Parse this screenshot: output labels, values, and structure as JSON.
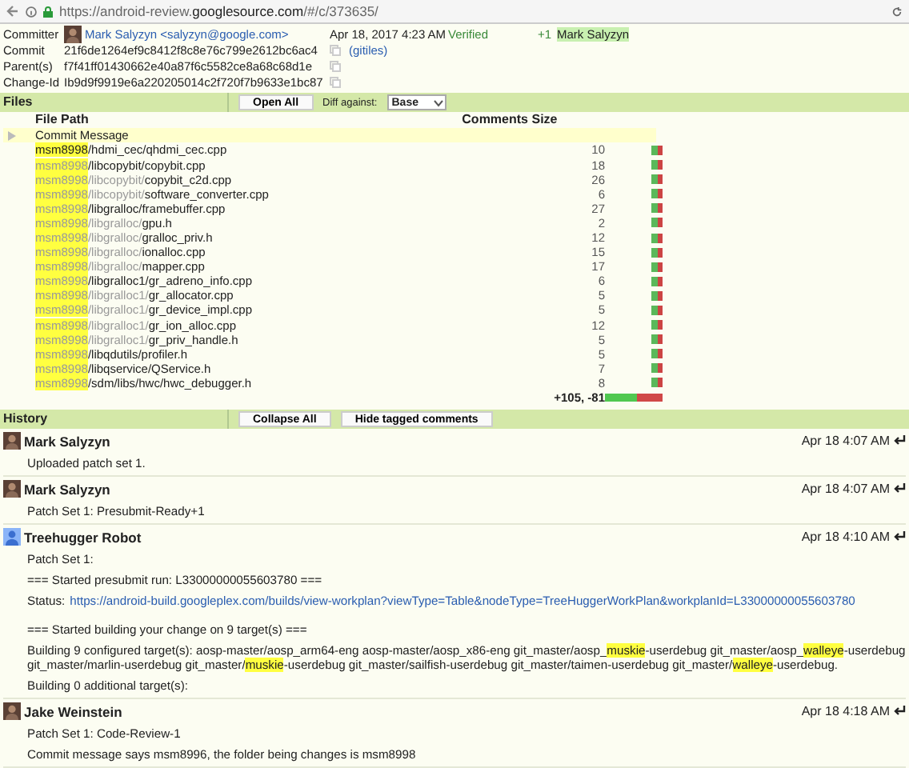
{
  "browser": {
    "url": "https://android-review.**googlesource.com**/#/c/373635/"
  },
  "info": {
    "rows": [
      {
        "label": "Committer",
        "value": "Mark Salyzyn <salyzyn@google.com>",
        "date": "Apr 18, 2017 4:23 AM",
        "copy": false
      },
      {
        "label": "Commit",
        "value": "21f6de1264ef9c8412f8c8e76c799e2612bc6ac4",
        "link": "(gitiles)",
        "copy": true
      },
      {
        "label": "Parent(s)",
        "value": "f7f41ff01430662e40a87f6c5582ce8a68c68d1e",
        "copy": true
      },
      {
        "label": "Change-Id",
        "value": "Ib9d9f9919e6a220205014c2f720f7b9633e1bc87",
        "copy": true
      }
    ],
    "label_name": "Verified",
    "vote": "+1",
    "voter": "Mark Salyzyn"
  },
  "files": {
    "title": "Files",
    "open_all": "Open All",
    "diff_label": "Diff against:",
    "diff_value": "Base",
    "columns": [
      "File Path",
      "Comments",
      "Size"
    ],
    "commit_message": "Commit Message",
    "rows": [
      {
        "path": [
          {
            "text": "msm8998",
            "highlighted": true,
            "dim": false
          },
          {
            "text": "/hdmi_cec/qhdmi_cec.cpp",
            "highlighted": false,
            "dim": false
          }
        ],
        "size": "10"
      },
      {
        "path": [
          {
            "text": "msm8998",
            "highlighted": true,
            "dim": true
          },
          {
            "text": "/libcopybit/copybit.cpp",
            "highlighted": false,
            "dim": false
          }
        ],
        "size": "18"
      },
      {
        "path": [
          {
            "text": "msm8998",
            "highlighted": true,
            "dim": true
          },
          {
            "text": "/libcopybit/",
            "highlighted": false,
            "dim": true
          },
          {
            "text": "copybit_c2d.cpp",
            "highlighted": false,
            "dim": false
          }
        ],
        "size": "26"
      },
      {
        "path": [
          {
            "text": "msm8998",
            "highlighted": true,
            "dim": true
          },
          {
            "text": "/libcopybit/",
            "highlighted": false,
            "dim": true
          },
          {
            "text": "software_converter.cpp",
            "highlighted": false,
            "dim": false
          }
        ],
        "size": "6"
      },
      {
        "path": [
          {
            "text": "msm8998",
            "highlighted": true,
            "dim": true
          },
          {
            "text": "/libgralloc/framebuffer.cpp",
            "highlighted": false,
            "dim": false
          }
        ],
        "size": "27"
      },
      {
        "path": [
          {
            "text": "msm8998",
            "highlighted": true,
            "dim": true
          },
          {
            "text": "/libgralloc/",
            "highlighted": false,
            "dim": true
          },
          {
            "text": "gpu.h",
            "highlighted": false,
            "dim": false
          }
        ],
        "size": "2"
      },
      {
        "path": [
          {
            "text": "msm8998",
            "highlighted": true,
            "dim": true
          },
          {
            "text": "/libgralloc/",
            "highlighted": false,
            "dim": true
          },
          {
            "text": "gralloc_priv.h",
            "highlighted": false,
            "dim": false
          }
        ],
        "size": "12"
      },
      {
        "path": [
          {
            "text": "msm8998",
            "highlighted": true,
            "dim": true
          },
          {
            "text": "/libgralloc/",
            "highlighted": false,
            "dim": true
          },
          {
            "text": "ionalloc.cpp",
            "highlighted": false,
            "dim": false
          }
        ],
        "size": "15"
      },
      {
        "path": [
          {
            "text": "msm8998",
            "highlighted": true,
            "dim": true
          },
          {
            "text": "/libgralloc/",
            "highlighted": false,
            "dim": true
          },
          {
            "text": "mapper.cpp",
            "highlighted": false,
            "dim": false
          }
        ],
        "size": "17"
      },
      {
        "path": [
          {
            "text": "msm8998",
            "highlighted": true,
            "dim": true
          },
          {
            "text": "/libgralloc1/gr_adreno_info.cpp",
            "highlighted": false,
            "dim": false
          }
        ],
        "size": "6"
      },
      {
        "path": [
          {
            "text": "msm8998",
            "highlighted": true,
            "dim": true
          },
          {
            "text": "/libgralloc1/",
            "highlighted": false,
            "dim": true
          },
          {
            "text": "gr_allocator.cpp",
            "highlighted": false,
            "dim": false
          }
        ],
        "size": "5"
      },
      {
        "path": [
          {
            "text": "msm8998",
            "highlighted": true,
            "dim": true
          },
          {
            "text": "/libgralloc1/",
            "highlighted": false,
            "dim": true
          },
          {
            "text": "gr_device_impl.cpp",
            "highlighted": false,
            "dim": false
          }
        ],
        "size": "5"
      },
      {
        "path": [
          {
            "text": "msm8998",
            "highlighted": true,
            "dim": true
          },
          {
            "text": "/libgralloc1/",
            "highlighted": false,
            "dim": true
          },
          {
            "text": "gr_ion_alloc.cpp",
            "highlighted": false,
            "dim": false
          }
        ],
        "size": "12"
      },
      {
        "path": [
          {
            "text": "msm8998",
            "highlighted": true,
            "dim": true
          },
          {
            "text": "/libgralloc1/",
            "highlighted": false,
            "dim": true
          },
          {
            "text": "gr_priv_handle.h",
            "highlighted": false,
            "dim": false
          }
        ],
        "size": "5"
      },
      {
        "path": [
          {
            "text": "msm8998",
            "highlighted": true,
            "dim": true
          },
          {
            "text": "/libqdutils/profiler.h",
            "highlighted": false,
            "dim": false
          }
        ],
        "size": "5"
      },
      {
        "path": [
          {
            "text": "msm8998",
            "highlighted": true,
            "dim": true
          },
          {
            "text": "/libqservice/QService.h",
            "highlighted": false,
            "dim": false
          }
        ],
        "size": "7"
      },
      {
        "path": [
          {
            "text": "msm8998",
            "highlighted": true,
            "dim": true
          },
          {
            "text": "/sdm/libs/hwc/hwc_debugger.h",
            "highlighted": false,
            "dim": false
          }
        ],
        "size": "8"
      }
    ],
    "total": "+105, -81",
    "total_bar": {
      "level": 0.56
    }
  },
  "history": {
    "title": "History",
    "buttons": [
      "Collapse All",
      "Hide tagged comments"
    ],
    "entries": [
      {
        "author": "Mark Salyzyn",
        "kind": "person",
        "date": "Apr 18 4:07 AM",
        "paragraphs": [
          [
            {
              "kind": "text",
              "text": "Uploaded patch set 1."
            }
          ]
        ]
      },
      {
        "author": "Mark Salyzyn",
        "kind": "person",
        "date": "Apr 18 4:07 AM",
        "paragraphs": [
          [
            {
              "kind": "text",
              "text": "Patch Set 1: Presubmit-Ready+1"
            }
          ]
        ]
      },
      {
        "author": "Treehugger Robot",
        "kind": "robot",
        "date": "Apr 18 4:10 AM",
        "paragraphs": [
          [
            {
              "kind": "text",
              "text": "Patch Set 1:"
            }
          ],
          [
            {
              "kind": "text",
              "text": "=== Started presubmit run: L33000000055603780 ==="
            }
          ],
          [
            {
              "kind": "text",
              "text": "Status:"
            },
            {
              "kind": "link",
              "text": "https://android-build.googleplex.com/builds/view-workplan?viewType=Table&nodeType=TreeHuggerWorkPlan&workplanId=L33000000055603780"
            }
          ],
          [
            {
              "kind": "text",
              "text": "=== Started building your change on 9 target(s) ==="
            }
          ],
          [
            {
              "kind": "text",
              "text": "Building 9 configured target(s): aosp-master/aosp_arm64-eng aosp-master/aosp_x86-eng git_master/aosp_"
            },
            {
              "kind": "highlight",
              "text": "muskie"
            },
            {
              "kind": "text",
              "text": "-userdebug git_master/aosp_"
            },
            {
              "kind": "highlight",
              "text": "walleye"
            },
            {
              "kind": "text",
              "text": "-userdebug git_master/marlin-userdebug git_master/"
            },
            {
              "kind": "highlight",
              "text": "muskie"
            },
            {
              "kind": "text",
              "text": "-userdebug git_master/sailfish-userdebug git_master/taimen-userdebug git_master/"
            },
            {
              "kind": "highlight",
              "text": "walleye"
            },
            {
              "kind": "text",
              "text": "-userdebug."
            }
          ],
          [
            {
              "kind": "text",
              "text": "Building 0 additional target(s):"
            }
          ]
        ]
      },
      {
        "author": "Jake Weinstein",
        "kind": "person",
        "date": "Apr 18 4:18 AM",
        "paragraphs": [
          [
            {
              "kind": "text",
              "text": "Patch Set 1: Code-Review-1"
            }
          ],
          [
            {
              "kind": "text",
              "text": "Commit message says msm8996, the folder being changes is msm8998"
            }
          ]
        ]
      }
    ]
  }
}
